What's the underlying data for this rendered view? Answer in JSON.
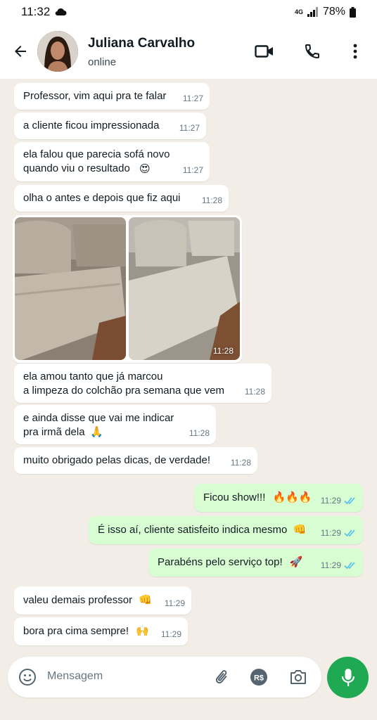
{
  "status_bar": {
    "time": "11:32",
    "network": "4G",
    "battery": "78%"
  },
  "header": {
    "contact_name": "Juliana Carvalho",
    "contact_status": "online"
  },
  "messages": [
    {
      "text": "Professor, vim aqui pra te falar",
      "time": "11:27"
    },
    {
      "text": "a cliente ficou impressionada",
      "time": "11:27"
    },
    {
      "text": "ela falou que parecia sofá novo\nquando viu o resultado",
      "emoji": "😍",
      "time": "11:27"
    },
    {
      "text": "olha o antes e depois que fiz aqui",
      "time": "11:28"
    },
    {
      "photo_time": "11:28"
    },
    {
      "text": "ela amou tanto que já marcou\na limpeza do colchão pra semana que vem",
      "time": "11:28"
    },
    {
      "text": "e ainda disse que vai me indicar\npra irmã dela",
      "emoji": "🙏",
      "time": "11:28"
    },
    {
      "text": "muito obrigado pelas dicas, de verdade!",
      "time": "11:28"
    },
    {
      "text": "Ficou show!!!",
      "emoji": "🔥🔥🔥",
      "time": "11:29",
      "outgoing": true
    },
    {
      "text": "É isso aí, cliente satisfeito indica mesmo",
      "emoji": "👊",
      "time": "11:29",
      "outgoing": true
    },
    {
      "text": "Parabéns pelo serviço top!",
      "emoji": "🚀",
      "time": "11:29",
      "outgoing": true
    },
    {
      "text": "valeu demais professor",
      "emoji": "👊",
      "time": "11:29"
    },
    {
      "text": "bora pra cima sempre!",
      "emoji": "🙌",
      "time": "11:29"
    }
  ],
  "input": {
    "placeholder": "Mensagem",
    "currency_label": "R$"
  },
  "icons": [
    "back-arrow-icon",
    "video-call-icon",
    "phone-icon",
    "more-vert-icon",
    "emoji-icon",
    "attach-icon",
    "payment-icon",
    "camera-icon",
    "mic-icon"
  ],
  "colors": {
    "chat_background": "#f2eee7",
    "outgoing_bubble": "#d9fdd3",
    "incoming_bubble": "#ffffff",
    "accent_green": "#1ea952",
    "read_ticks": "#53bdeb"
  }
}
